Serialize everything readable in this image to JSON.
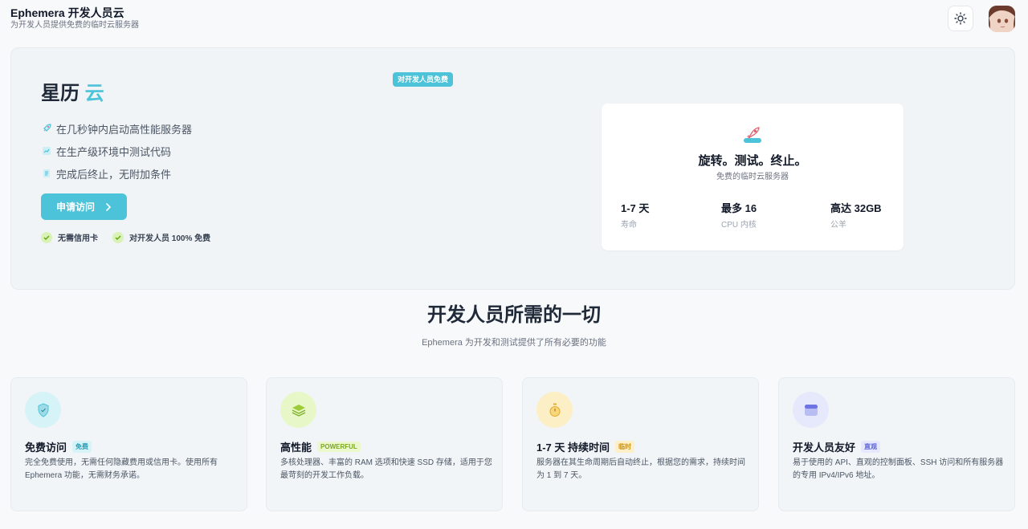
{
  "header": {
    "title": "Ephemera 开发人员云",
    "subtitle": "为开发人员提供免费的临时云服务器",
    "theme_toggle_icon": "sun-icon"
  },
  "hero": {
    "title_main": "星历",
    "title_accent": "云",
    "badge": "对开发人员免费",
    "features": [
      {
        "icon": "rocket-icon",
        "text": "在几秒钟内启动高性能服务器"
      },
      {
        "icon": "chart-icon",
        "text": "在生产级环境中测试代码"
      },
      {
        "icon": "document-icon",
        "text": "完成后终止，无附加条件"
      }
    ],
    "cta_label": "申请访问",
    "checks": [
      "无需信用卡",
      "对开发人员 100% 免费"
    ]
  },
  "info_card": {
    "title": "旋转。测试。终止。",
    "subtitle": "免费的临时云服务器",
    "stats": [
      {
        "value": "1-7 天",
        "label": "寿命"
      },
      {
        "value": "最多 16",
        "label": "CPU 内核"
      },
      {
        "value": "高达 32GB",
        "label": "公羊"
      }
    ]
  },
  "section": {
    "title": "开发人员所需的一切",
    "subtitle": "Ephemera 为开发和测试提供了所有必要的功能"
  },
  "cards": [
    {
      "icon": "shield-icon",
      "title": "免费访问",
      "tag": "免费",
      "desc": "完全免费使用，无需任何隐藏费用或信用卡。使用所有 Ephemera 功能，无需财务承诺。"
    },
    {
      "icon": "layers-icon",
      "title": "高性能",
      "tag": "POWERFUL",
      "desc": "多核处理器、丰富的 RAM 选项和快速 SSD 存储，适用于您最苛刻的开发工作负载。"
    },
    {
      "icon": "stopwatch-icon",
      "title": "1-7 天 持续时间",
      "tag": "临时",
      "desc": "服务器在其生命周期后自动终止，根据您的需求，持续时间为 1 到 7 天。"
    },
    {
      "icon": "window-icon",
      "title": "开发人员友好",
      "tag": "直观",
      "desc": "易于使用的 API、直观的控制面板、SSH 访问和所有服务器的专用 IPv4/IPv6 地址。"
    }
  ],
  "colors": {
    "accent": "#4cc3d9",
    "check_bg": "#d9f2b5"
  }
}
